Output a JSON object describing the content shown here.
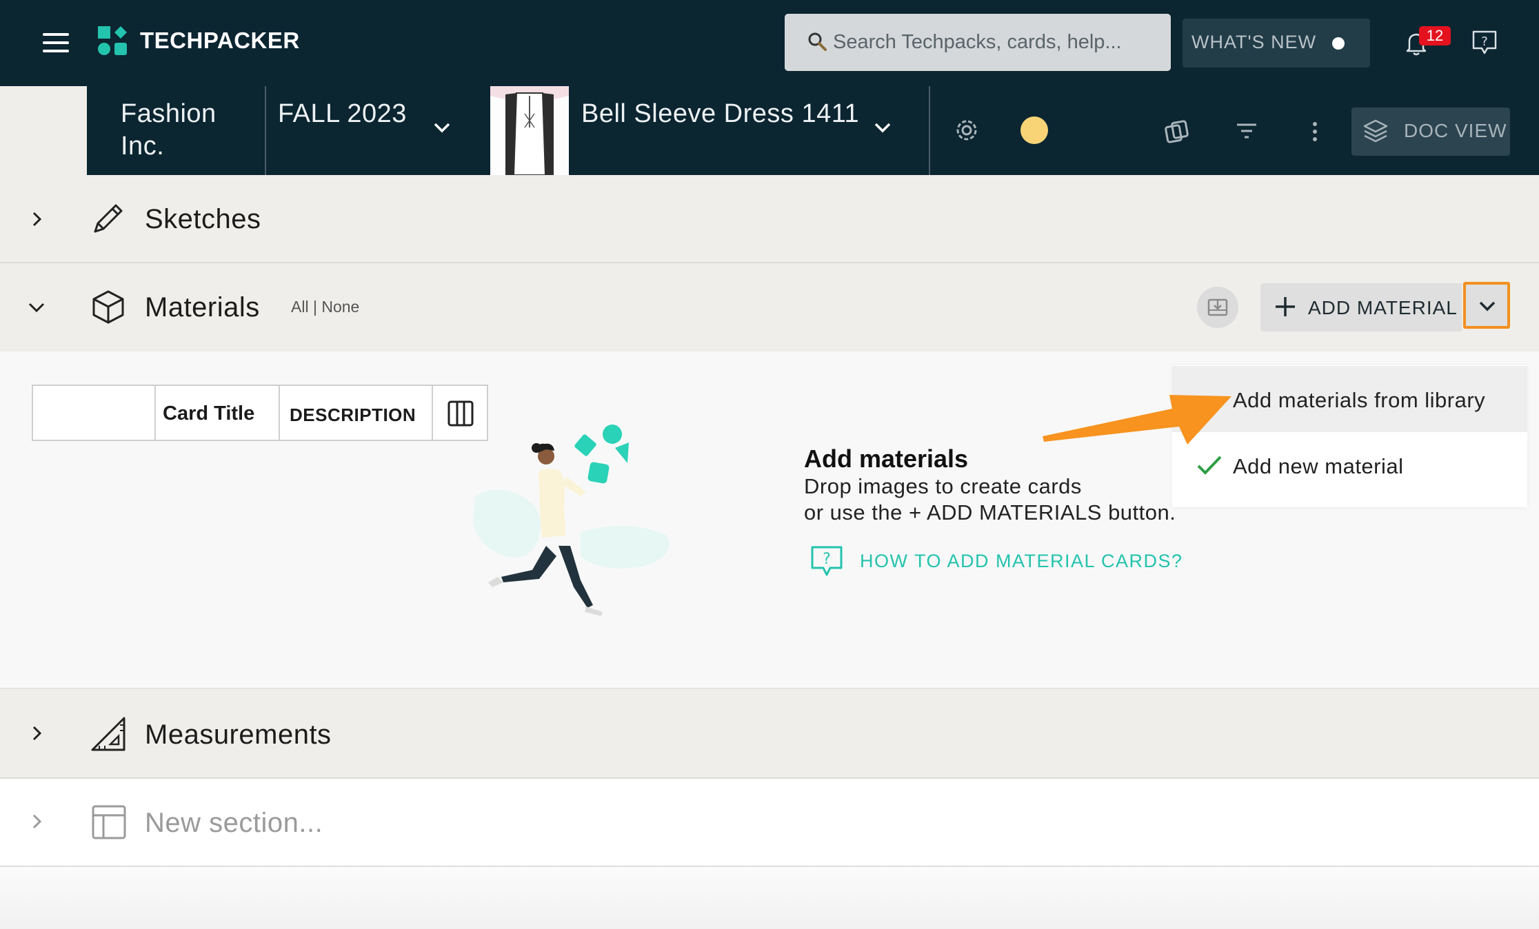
{
  "app": {
    "name": "TECHPACKER"
  },
  "search": {
    "placeholder": "Search Techpacks, cards, help..."
  },
  "header": {
    "whats_new_label": "WHAT'S NEW",
    "notification_count": "12"
  },
  "breadcrumb": {
    "company": "Fashion Inc.",
    "season": "FALL 2023",
    "product": "Bell Sleeve Dress 1411",
    "doc_view_label": "DOC VIEW"
  },
  "sections": {
    "sketches": {
      "label": "Sketches"
    },
    "materials": {
      "label": "Materials",
      "filter_all": "All",
      "filter_sep": "|",
      "filter_none": "None",
      "add_label": "ADD MATERIAL"
    },
    "measurements": {
      "label": "Measurements"
    },
    "new_section": {
      "label": "New section..."
    }
  },
  "table": {
    "columns": [
      "",
      "Card Title",
      "DESCRIPTION"
    ]
  },
  "empty_state": {
    "title": "Add materials",
    "line1": "Drop images to create cards",
    "line2": "or use the + ADD MATERIALS button.",
    "help_link": "HOW TO ADD MATERIAL CARDS?"
  },
  "dropdown": {
    "items": [
      {
        "label": "Add materials from library"
      },
      {
        "label": "Add new material"
      }
    ]
  },
  "colors": {
    "topbar": "#0b2531",
    "accent": "#23c3ad",
    "highlight": "#f2901f",
    "status": "#f8d477",
    "badge": "#e4121f"
  },
  "icons": {
    "menu": "hamburger-icon",
    "search": "search-icon",
    "notifications": "bell-icon",
    "feedback": "feedback-icon",
    "settings": "gear-icon",
    "copy": "copy-icon",
    "filter": "filter-icon",
    "more": "more-vertical-icon",
    "doc_view": "layers-icon"
  }
}
